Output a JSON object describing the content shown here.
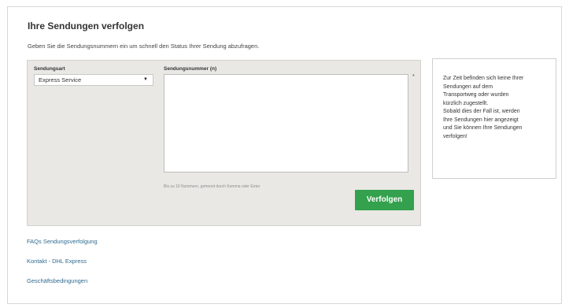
{
  "page": {
    "title": "Ihre Sendungen verfolgen",
    "intro": "Geben Sie die Sendungsnummern ein um schnell den Status Ihrer Sendung abzufragen."
  },
  "form": {
    "shipment_type_label": "Sendungsart",
    "shipment_type_value": "Express Service",
    "tracking_label": "Sendungsnummer (n)",
    "required_mark": "*",
    "hint": "Bis zu 10 Nummern, getrennt durch Komma oder Enter",
    "submit_label": "Verfolgen",
    "tracking_value": ""
  },
  "info_box": {
    "lines": [
      "Zur Zeit befinden sich keine Ihrer",
      "Sendungen auf dem",
      "Transportweg oder wurden",
      "kürzlich zugestellt.",
      "Sobald dies der Fall ist, werden",
      "Ihre Sendungen hier angezeigt",
      "und Sie können Ihre Sendungen",
      "verfolgen!"
    ]
  },
  "links": {
    "faq": "FAQs Sendungsverfolgung",
    "contact": "Kontakt - DHL Express",
    "terms": "Geschäftsbedingungen"
  },
  "colors": {
    "accent_button": "#33a14d",
    "panel_bg": "#e9e8e4",
    "link": "#2f6b8f"
  },
  "icons": {
    "select_caret": "caret-down-icon"
  }
}
